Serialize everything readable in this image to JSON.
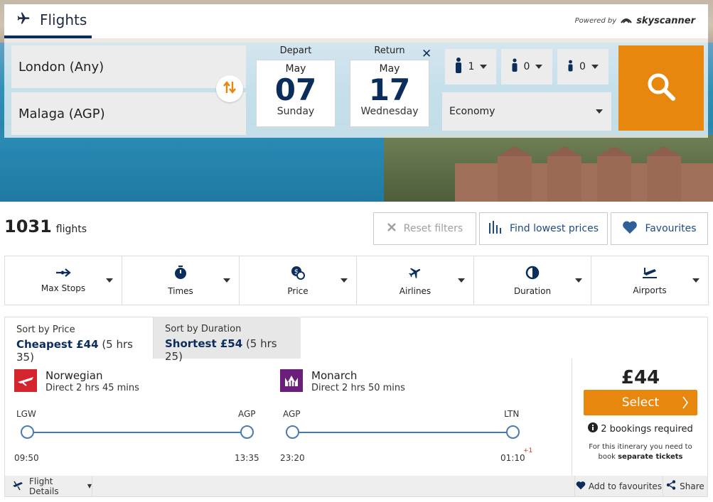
{
  "header": {
    "tab_label": "Flights",
    "powered_by": "Powered by",
    "brand": "skyscanner"
  },
  "search": {
    "origin": "London (Any)",
    "destination": "Malaga (AGP)",
    "depart": {
      "label": "Depart",
      "month": "May",
      "day": "07",
      "weekday": "Sunday"
    },
    "return": {
      "label": "Return",
      "month": "May",
      "day": "17",
      "weekday": "Wednesday"
    },
    "close_symbol": "✕",
    "passengers": {
      "adults": "1",
      "children": "0",
      "infants": "0"
    },
    "cabin_class": "Economy"
  },
  "results": {
    "count": "1031",
    "count_unit": "flights",
    "reset_label": "Reset filters",
    "lowest_label": "Find lowest prices",
    "favourites_label": "Favourites"
  },
  "filters": [
    "Max Stops",
    "Times",
    "Price",
    "Airlines",
    "Duration",
    "Airports"
  ],
  "sort": {
    "price": {
      "label": "Sort by Price",
      "strong": "Cheapest £44",
      "detail": "(5 hrs 35)"
    },
    "duration": {
      "label": "Sort by Duration",
      "strong": "Shortest £54",
      "detail": "(5 hrs 25)"
    }
  },
  "itinerary": {
    "outbound": {
      "airline": "Norwegian",
      "info": "Direct  2 hrs 45 mins",
      "from": "LGW",
      "to": "AGP",
      "dep_time": "09:50",
      "arr_time": "13:35"
    },
    "inbound": {
      "airline": "Monarch",
      "info": "Direct  2 hrs 50 mins",
      "from": "AGP",
      "to": "LTN",
      "dep_time": "23:20",
      "arr_time": "01:10",
      "day_offset": "+1"
    },
    "price": "£44",
    "select_label": "Select",
    "bookings": "2 bookings required",
    "note_prefix": "For this itinerary you need to book",
    "note_bold": "separate tickets"
  },
  "footer": {
    "details_label": "Flight Details",
    "add_fav_label": "Add to favourites",
    "share_label": "Share"
  },
  "colors": {
    "accent_orange": "#e8870e",
    "navy": "#0b2d5c",
    "link_blue": "#1c4b84",
    "timeline_blue": "#4a7bb0",
    "norwegian_red": "#d4252f",
    "monarch_purple": "#6b1e7a"
  }
}
